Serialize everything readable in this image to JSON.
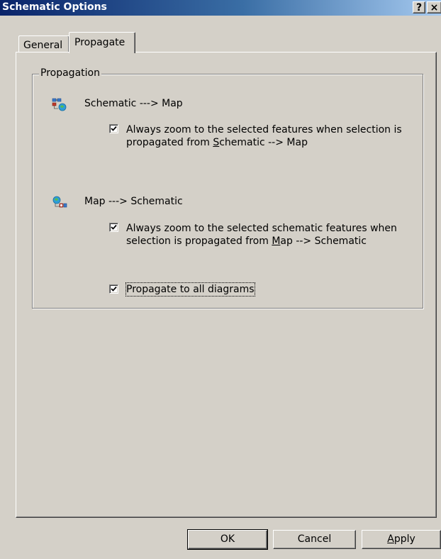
{
  "window": {
    "title": "Schematic Options",
    "help_label": "?",
    "close_label": "×"
  },
  "tabs": [
    {
      "label": "General",
      "selected": false
    },
    {
      "label": "Propagate",
      "selected": true
    }
  ],
  "propagation": {
    "group_label": "Propagation",
    "schematic_to_map": {
      "label": "Schematic ---> Map",
      "icon": "schematic-to-map-icon",
      "zoom_checkbox": {
        "checked": true,
        "line1": "Always zoom to the selected features when selection is",
        "line2_prefix": "propagated from ",
        "line2_mnemonic": "S",
        "line2_suffix": "chematic --> Map"
      }
    },
    "map_to_schematic": {
      "label": "Map ---> Schematic",
      "icon": "map-to-schematic-icon",
      "zoom_checkbox": {
        "checked": true,
        "line1": "Always zoom to the selected schematic features when",
        "line2_prefix": "selection is propagated from ",
        "line2_mnemonic": "M",
        "line2_suffix": "ap --> Schematic"
      },
      "all_diagrams_checkbox": {
        "checked": true,
        "label": "Propagate to all diagrams"
      }
    }
  },
  "buttons": {
    "ok": "OK",
    "cancel": "Cancel",
    "apply_mnemonic": "A",
    "apply_rest": "pply"
  }
}
